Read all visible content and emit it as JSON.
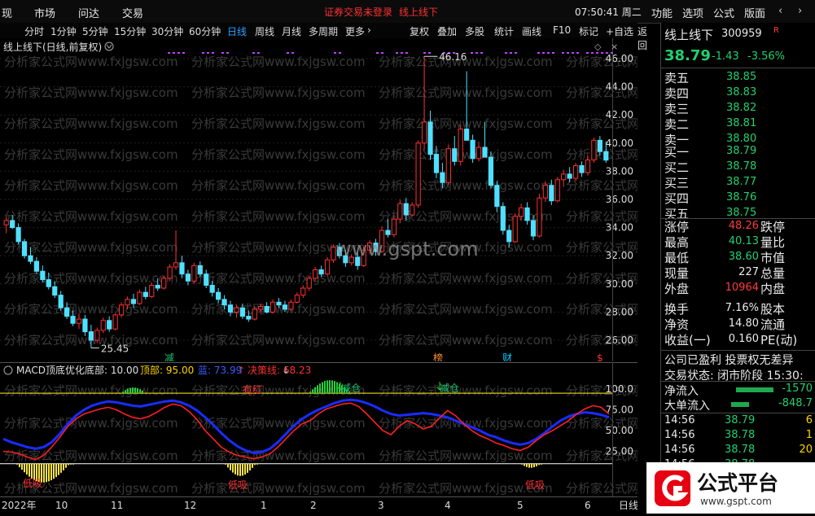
{
  "topbar": {
    "menus": [
      "现",
      "市场",
      "问达",
      "交易"
    ],
    "notice": "证券交易未登录",
    "stock_title": "线上线下",
    "clock": "07:50:41 周二",
    "right_menus": [
      "功能",
      "选项",
      "公式",
      "版面"
    ]
  },
  "periods": [
    "分时",
    "1分钟",
    "5分钟",
    "15分钟",
    "30分钟",
    "60分钟",
    "日线",
    "周线",
    "月线",
    "多周期",
    "更多"
  ],
  "active_period": "日线",
  "tools": [
    "复权",
    "叠加",
    "多股",
    "统计",
    "画线",
    "F10",
    "标记",
    "+自选",
    "返回"
  ],
  "main": {
    "title": "线上线下(日线,前复权)",
    "y_ticks": [
      "46.00",
      "44.00",
      "42.00",
      "40.00",
      "38.00",
      "36.00",
      "34.00",
      "32.00",
      "30.00",
      "28.00",
      "26.00"
    ],
    "hi_label": "46.16",
    "lo_label": "25.45",
    "site": "www.gspt.com",
    "events": [
      "减",
      "榜",
      "财",
      "$"
    ],
    "watermark": "分析家公式网www.fxjgsw.com"
  },
  "sub": {
    "name": "MACD顶底优化",
    "bottom": "底部: 10.00",
    "top": "顶部: 95.00",
    "blue": "蓝: 73.99",
    "cross": "决策线: 68.23",
    "y_ticks": [
      "100.0",
      "75.00",
      "50.00",
      "25.00"
    ],
    "labels": [
      "有红",
      "减仓",
      "减仓",
      "低吸",
      "低吸",
      "低吸"
    ]
  },
  "x_axis": [
    "2022年",
    "10",
    "11",
    "12",
    "1",
    "2",
    "3",
    "4",
    "5",
    "6",
    "日线"
  ],
  "quote": {
    "name": "线上线下",
    "code": "300959",
    "badge": "R",
    "price": "38.79",
    "change": "-1.43",
    "pct": "-3.56%",
    "sells": [
      [
        "卖五",
        "38.85"
      ],
      [
        "卖四",
        "38.83"
      ],
      [
        "卖三",
        "38.82"
      ],
      [
        "卖二",
        "38.81"
      ],
      [
        "卖一",
        "38.80"
      ]
    ],
    "buys": [
      [
        "买一",
        "38.79"
      ],
      [
        "买二",
        "38.78"
      ],
      [
        "买三",
        "38.77"
      ],
      [
        "买四",
        "38.76"
      ],
      [
        "买五",
        "38.75"
      ]
    ],
    "stats": [
      [
        "涨停",
        "48.26",
        "跌停"
      ],
      [
        "最高",
        "40.13",
        "量比"
      ],
      [
        "最低",
        "38.60",
        "市值"
      ],
      [
        "现量",
        "227",
        "总量"
      ],
      [
        "外盘",
        "10964",
        "内盘"
      ],
      [
        "换手",
        "7.16%",
        "股本"
      ],
      [
        "净资",
        "14.80",
        "流通"
      ],
      [
        "收益(一)",
        "0.160",
        "PE(动)"
      ]
    ],
    "company": "公司已盈利 投票权无差异",
    "trade_state": "交易状态: 闭市阶段 15:30:",
    "flows": [
      [
        "净流入",
        "-1570"
      ],
      [
        "大单流入",
        "-848.7"
      ]
    ],
    "ticks": [
      [
        "14:56",
        "38.79",
        "6"
      ],
      [
        "14:56",
        "38.78",
        "1"
      ],
      [
        "14:56",
        "38.78",
        "20"
      ],
      [
        "14:56",
        "38.78",
        ""
      ]
    ],
    "logo": "公式平台",
    "logo_url": "www.gspt.com"
  },
  "chart_data": {
    "type": "candlestick",
    "ylim": [
      25,
      47
    ],
    "candles": [
      [
        34.2,
        34.8,
        33.6,
        34.5
      ],
      [
        34.5,
        34.9,
        33.9,
        34.0
      ],
      [
        34.0,
        34.3,
        32.8,
        33.0
      ],
      [
        33.0,
        33.2,
        31.8,
        32.0
      ],
      [
        32.0,
        32.6,
        31.4,
        31.6
      ],
      [
        31.6,
        31.9,
        30.7,
        30.9
      ],
      [
        30.9,
        31.3,
        30.1,
        30.3
      ],
      [
        30.3,
        30.8,
        29.6,
        29.8
      ],
      [
        29.8,
        30.2,
        29.0,
        29.2
      ],
      [
        29.2,
        29.5,
        28.1,
        28.3
      ],
      [
        28.3,
        28.7,
        27.5,
        27.7
      ],
      [
        27.7,
        28.1,
        27.0,
        27.2
      ],
      [
        27.2,
        27.9,
        26.8,
        27.5
      ],
      [
        27.5,
        27.8,
        26.3,
        26.6
      ],
      [
        26.6,
        27.1,
        25.45,
        26.0
      ],
      [
        26.0,
        26.9,
        25.8,
        26.7
      ],
      [
        26.7,
        27.6,
        26.5,
        27.4
      ],
      [
        27.4,
        27.7,
        26.6,
        26.8
      ],
      [
        26.8,
        27.9,
        26.7,
        27.8
      ],
      [
        27.8,
        28.7,
        27.6,
        28.5
      ],
      [
        28.5,
        29.1,
        28.2,
        28.9
      ],
      [
        28.9,
        29.3,
        28.3,
        28.6
      ],
      [
        28.6,
        29.6,
        28.5,
        29.4
      ],
      [
        29.4,
        29.8,
        28.9,
        29.1
      ],
      [
        29.1,
        30.1,
        29.0,
        29.9
      ],
      [
        29.9,
        30.4,
        29.5,
        29.7
      ],
      [
        29.7,
        30.6,
        29.6,
        30.4
      ],
      [
        30.4,
        31.4,
        30.2,
        31.2
      ],
      [
        31.2,
        33.8,
        31.0,
        31.5
      ],
      [
        31.5,
        32.0,
        30.4,
        30.7
      ],
      [
        30.7,
        31.0,
        29.9,
        30.2
      ],
      [
        30.2,
        31.5,
        30.0,
        31.3
      ],
      [
        31.3,
        31.6,
        30.5,
        30.7
      ],
      [
        30.7,
        31.0,
        29.7,
        29.9
      ],
      [
        29.9,
        30.2,
        29.1,
        29.4
      ],
      [
        29.4,
        29.7,
        28.6,
        28.9
      ],
      [
        28.9,
        29.2,
        28.2,
        28.5
      ],
      [
        28.5,
        28.8,
        27.7,
        28.0
      ],
      [
        28.0,
        28.5,
        27.6,
        28.3
      ],
      [
        28.3,
        28.6,
        27.5,
        27.7
      ],
      [
        27.7,
        28.1,
        27.3,
        27.5
      ],
      [
        27.5,
        28.4,
        27.4,
        28.2
      ],
      [
        28.2,
        28.6,
        27.9,
        28.4
      ],
      [
        28.4,
        28.7,
        27.9,
        28.0
      ],
      [
        28.0,
        28.9,
        27.9,
        28.7
      ],
      [
        28.7,
        29.0,
        28.3,
        28.5
      ],
      [
        28.5,
        28.8,
        28.0,
        28.2
      ],
      [
        28.2,
        28.9,
        28.1,
        28.7
      ],
      [
        28.7,
        29.4,
        28.6,
        29.2
      ],
      [
        29.2,
        29.9,
        29.0,
        29.7
      ],
      [
        29.7,
        30.6,
        29.5,
        30.4
      ],
      [
        30.4,
        31.2,
        30.2,
        31.0
      ],
      [
        31.0,
        31.3,
        30.5,
        30.7
      ],
      [
        30.7,
        31.9,
        30.6,
        31.7
      ],
      [
        31.7,
        32.8,
        31.5,
        32.6
      ],
      [
        32.6,
        32.9,
        31.8,
        32.0
      ],
      [
        32.0,
        32.4,
        31.2,
        31.5
      ],
      [
        31.5,
        32.1,
        31.3,
        31.9
      ],
      [
        31.9,
        32.3,
        31.0,
        31.3
      ],
      [
        31.3,
        32.6,
        31.2,
        32.4
      ],
      [
        32.4,
        33.1,
        32.1,
        32.9
      ],
      [
        32.9,
        33.2,
        32.0,
        32.3
      ],
      [
        32.3,
        34.1,
        32.2,
        33.8
      ],
      [
        33.8,
        34.6,
        33.3,
        33.5
      ],
      [
        33.5,
        34.8,
        33.3,
        34.6
      ],
      [
        34.6,
        36.0,
        34.3,
        35.7
      ],
      [
        35.7,
        36.1,
        34.5,
        34.9
      ],
      [
        34.9,
        35.8,
        34.8,
        35.6
      ],
      [
        35.6,
        40.2,
        35.4,
        40.0
      ],
      [
        40.0,
        46.16,
        39.5,
        41.5
      ],
      [
        41.5,
        42.3,
        38.8,
        39.2
      ],
      [
        39.2,
        39.8,
        37.5,
        37.9
      ],
      [
        37.9,
        38.6,
        36.8,
        37.2
      ],
      [
        37.2,
        39.9,
        37.0,
        39.6
      ],
      [
        39.6,
        40.5,
        38.4,
        38.7
      ],
      [
        38.7,
        41.3,
        38.4,
        41.0
      ],
      [
        41.0,
        45.1,
        40.6,
        40.2
      ],
      [
        40.2,
        40.6,
        38.6,
        38.9
      ],
      [
        38.9,
        40.1,
        38.7,
        39.7
      ],
      [
        39.7,
        41.5,
        39.3,
        39.0
      ],
      [
        39.0,
        39.4,
        36.8,
        37.0
      ],
      [
        37.0,
        37.3,
        35.1,
        35.5
      ],
      [
        35.5,
        35.8,
        33.5,
        33.8
      ],
      [
        33.8,
        34.2,
        32.6,
        33.0
      ],
      [
        33.0,
        35.0,
        32.9,
        34.8
      ],
      [
        34.8,
        35.7,
        34.5,
        35.4
      ],
      [
        35.4,
        35.8,
        34.2,
        34.5
      ],
      [
        34.5,
        34.9,
        33.1,
        33.4
      ],
      [
        33.4,
        36.4,
        33.3,
        36.1
      ],
      [
        36.1,
        37.3,
        35.8,
        37.0
      ],
      [
        37.0,
        37.4,
        35.6,
        35.9
      ],
      [
        35.9,
        37.6,
        35.8,
        37.4
      ],
      [
        37.4,
        38.1,
        36.9,
        37.8
      ],
      [
        37.8,
        38.3,
        37.2,
        37.5
      ],
      [
        37.5,
        38.6,
        37.3,
        38.4
      ],
      [
        38.4,
        38.7,
        37.6,
        37.9
      ],
      [
        37.9,
        39.1,
        37.7,
        38.8
      ],
      [
        38.8,
        40.4,
        38.6,
        40.2
      ],
      [
        40.2,
        40.5,
        39.1,
        39.4
      ],
      [
        39.4,
        40.13,
        38.6,
        38.79
      ]
    ],
    "indicator": {
      "blue": [
        40,
        36,
        33,
        30,
        28,
        30,
        36,
        46,
        58,
        68,
        75,
        80,
        83,
        85,
        84,
        82,
        80,
        79,
        81,
        83,
        85,
        86,
        84,
        80,
        74,
        66,
        57,
        47,
        38,
        31,
        26,
        23,
        24,
        28,
        36,
        46,
        56,
        64,
        70,
        75,
        79,
        83,
        86,
        87,
        86,
        83,
        79,
        74,
        70,
        68,
        69,
        70,
        71,
        70,
        68,
        66,
        62,
        58,
        54,
        50,
        45,
        42,
        38,
        35,
        33,
        35,
        40,
        47,
        55,
        62,
        67,
        70,
        72,
        71,
        69,
        66
      ],
      "red": [
        25,
        24,
        22,
        18,
        15,
        20,
        30,
        42,
        55,
        64,
        70,
        73,
        76,
        78,
        75,
        70,
        66,
        64,
        67,
        72,
        78,
        82,
        80,
        73,
        63,
        50,
        40,
        30,
        24,
        20,
        18,
        16,
        18,
        22,
        30,
        40,
        50,
        58,
        62,
        70,
        76,
        79,
        82,
        83,
        79,
        70,
        60,
        50,
        45,
        55,
        62,
        58,
        52,
        55,
        65,
        74,
        68,
        58,
        50,
        44,
        40,
        35,
        32,
        28,
        26,
        30,
        38,
        45,
        50,
        56,
        62,
        70,
        76,
        80,
        78,
        70
      ],
      "hist_pos": [
        [
          44,
          48,
          6
        ],
        [
          116,
          130,
          10
        ],
        [
          310,
          325,
          10
        ]
      ],
      "hist_neg": [
        [
          8,
          22,
          -8
        ],
        [
          60,
          78,
          -14
        ],
        [
          210,
          228,
          -8
        ],
        [
          270,
          292,
          -5
        ]
      ]
    }
  }
}
